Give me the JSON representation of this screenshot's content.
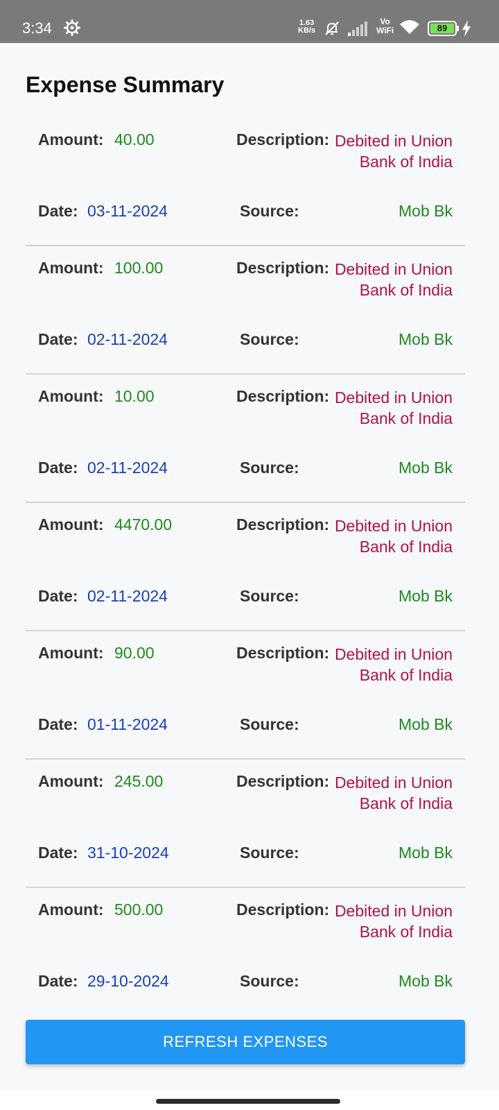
{
  "status_bar": {
    "time": "3:34",
    "net_speed_value": "1.63",
    "net_speed_unit": "KB/s",
    "vo": "Vo",
    "wifi": "WiFi",
    "battery": "89",
    "icons": [
      "gear-icon",
      "mute-icon",
      "signal-icon",
      "wifi-icon",
      "battery-icon",
      "bolt-icon"
    ]
  },
  "page": {
    "title": "Expense Summary",
    "labels": {
      "amount": "Amount:",
      "description": "Description:",
      "date": "Date:",
      "source": "Source:"
    }
  },
  "expenses": [
    {
      "amount": "40.00",
      "description": "Debited in Union Bank of India",
      "date": "03-11-2024",
      "source": "Mob Bk"
    },
    {
      "amount": "100.00",
      "description": "Debited in Union Bank of India",
      "date": "02-11-2024",
      "source": "Mob Bk"
    },
    {
      "amount": "10.00",
      "description": "Debited in Union Bank of India",
      "date": "02-11-2024",
      "source": "Mob Bk"
    },
    {
      "amount": "4470.00",
      "description": "Debited in Union Bank of India",
      "date": "02-11-2024",
      "source": "Mob Bk"
    },
    {
      "amount": "90.00",
      "description": "Debited in Union Bank of India",
      "date": "01-11-2024",
      "source": "Mob Bk"
    },
    {
      "amount": "245.00",
      "description": "Debited in Union Bank of India",
      "date": "31-10-2024",
      "source": "Mob Bk"
    },
    {
      "amount": "500.00",
      "description": "Debited in Union Bank of India",
      "date": "29-10-2024",
      "source": "Mob Bk"
    }
  ],
  "refresh_button": {
    "label": "REFRESH EXPENSES"
  },
  "colors": {
    "amount": "#1e8a1e",
    "description": "#b0124a",
    "date": "#1a3fb5",
    "source": "#1e8a1e",
    "button": "#2196f3",
    "status_bar": "#7a7a7a"
  }
}
